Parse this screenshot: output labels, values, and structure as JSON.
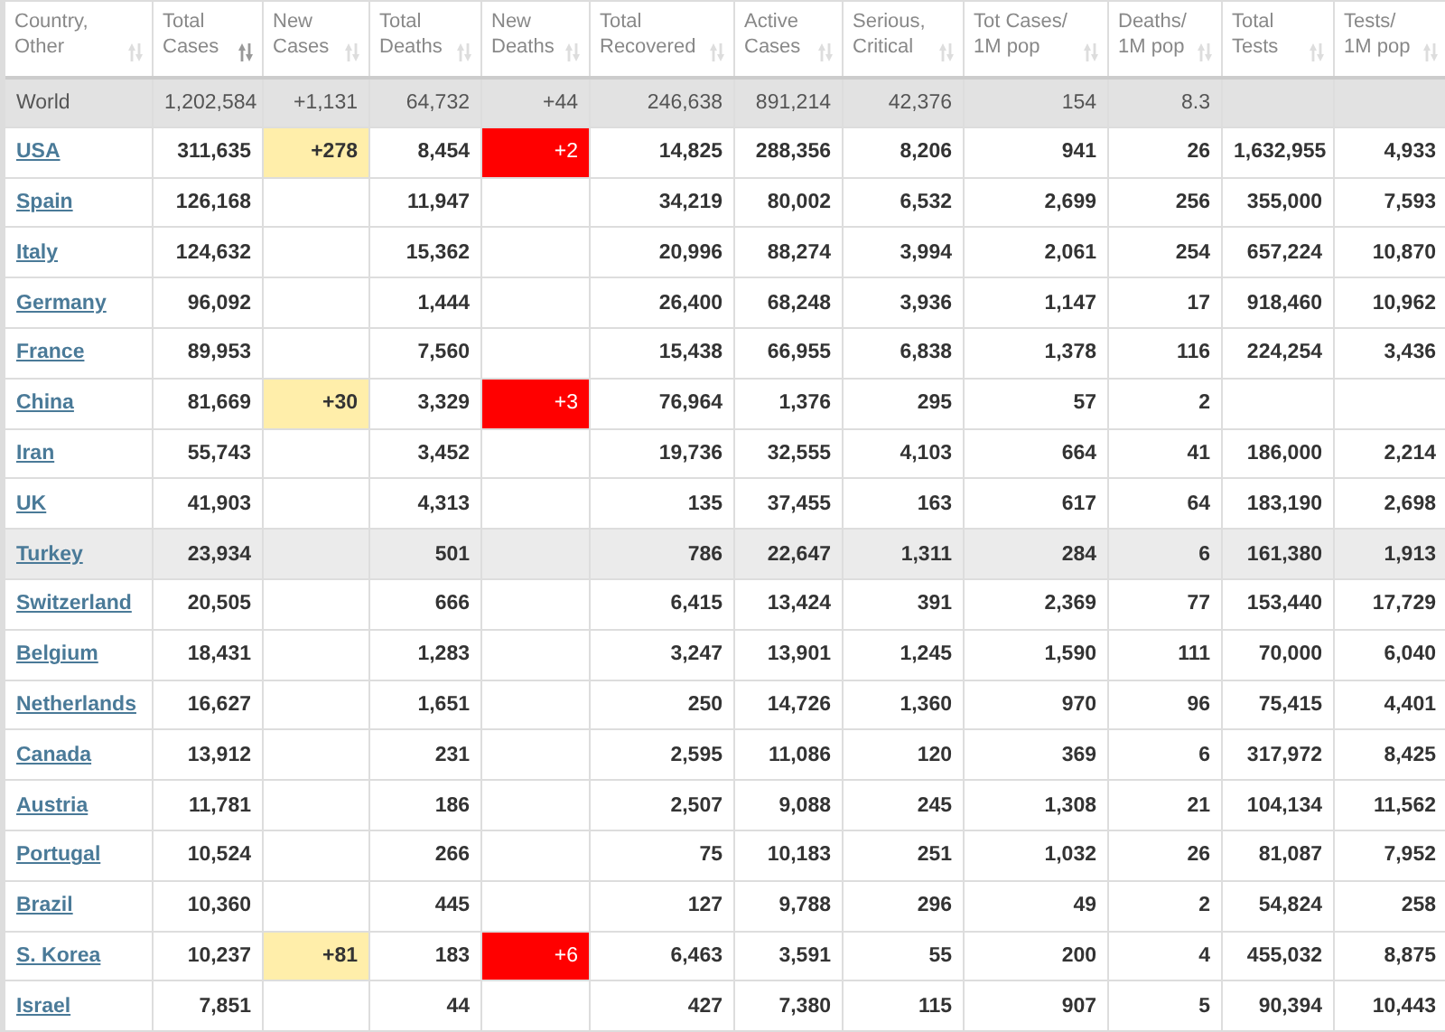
{
  "columns": [
    {
      "lines": [
        "Country,",
        "Other"
      ],
      "sorted": false
    },
    {
      "lines": [
        "Total",
        "Cases"
      ],
      "sorted": true
    },
    {
      "lines": [
        "New",
        "Cases"
      ],
      "sorted": false
    },
    {
      "lines": [
        "Total",
        "Deaths"
      ],
      "sorted": false
    },
    {
      "lines": [
        "New",
        "Deaths"
      ],
      "sorted": false
    },
    {
      "lines": [
        "Total",
        "Recovered"
      ],
      "sorted": false
    },
    {
      "lines": [
        "Active",
        "Cases"
      ],
      "sorted": false
    },
    {
      "lines": [
        "Serious,",
        "Critical"
      ],
      "sorted": false
    },
    {
      "lines": [
        "Tot Cases/",
        "1M pop"
      ],
      "sorted": false
    },
    {
      "lines": [
        "Deaths/",
        "1M pop"
      ],
      "sorted": false
    },
    {
      "lines": [
        "Total",
        "Tests"
      ],
      "sorted": false
    },
    {
      "lines": [
        "Tests/",
        "1M pop"
      ],
      "sorted": false
    }
  ],
  "world": {
    "country": "World",
    "total_cases": "1,202,584",
    "new_cases": "+1,131",
    "total_deaths": "64,732",
    "new_deaths": "+44",
    "total_recovered": "246,638",
    "active_cases": "891,214",
    "serious_critical": "42,376",
    "tot_cases_per_1m": "154",
    "deaths_per_1m": "8.3"
  },
  "rows": [
    {
      "hovered": false,
      "country": "USA",
      "total_cases": "311,635",
      "new_cases": "+278",
      "total_deaths": "8,454",
      "new_deaths": "+2",
      "total_recovered": "14,825",
      "active_cases": "288,356",
      "serious_critical": "8,206",
      "tot_cases_per_1m": "941",
      "deaths_per_1m": "26",
      "total_tests": "1,632,955",
      "tests_per_1m": "4,933"
    },
    {
      "hovered": false,
      "country": "Spain",
      "total_cases": "126,168",
      "total_deaths": "11,947",
      "total_recovered": "34,219",
      "active_cases": "80,002",
      "serious_critical": "6,532",
      "tot_cases_per_1m": "2,699",
      "deaths_per_1m": "256",
      "total_tests": "355,000",
      "tests_per_1m": "7,593"
    },
    {
      "hovered": false,
      "country": "Italy",
      "total_cases": "124,632",
      "total_deaths": "15,362",
      "total_recovered": "20,996",
      "active_cases": "88,274",
      "serious_critical": "3,994",
      "tot_cases_per_1m": "2,061",
      "deaths_per_1m": "254",
      "total_tests": "657,224",
      "tests_per_1m": "10,870"
    },
    {
      "hovered": false,
      "country": "Germany",
      "total_cases": "96,092",
      "total_deaths": "1,444",
      "total_recovered": "26,400",
      "active_cases": "68,248",
      "serious_critical": "3,936",
      "tot_cases_per_1m": "1,147",
      "deaths_per_1m": "17",
      "total_tests": "918,460",
      "tests_per_1m": "10,962"
    },
    {
      "hovered": false,
      "country": "France",
      "total_cases": "89,953",
      "total_deaths": "7,560",
      "total_recovered": "15,438",
      "active_cases": "66,955",
      "serious_critical": "6,838",
      "tot_cases_per_1m": "1,378",
      "deaths_per_1m": "116",
      "total_tests": "224,254",
      "tests_per_1m": "3,436"
    },
    {
      "hovered": false,
      "country": "China",
      "total_cases": "81,669",
      "new_cases": "+30",
      "total_deaths": "3,329",
      "new_deaths": "+3",
      "total_recovered": "76,964",
      "active_cases": "1,376",
      "serious_critical": "295",
      "tot_cases_per_1m": "57",
      "deaths_per_1m": "2"
    },
    {
      "hovered": false,
      "country": "Iran",
      "total_cases": "55,743",
      "total_deaths": "3,452",
      "total_recovered": "19,736",
      "active_cases": "32,555",
      "serious_critical": "4,103",
      "tot_cases_per_1m": "664",
      "deaths_per_1m": "41",
      "total_tests": "186,000",
      "tests_per_1m": "2,214"
    },
    {
      "hovered": false,
      "country": "UK",
      "total_cases": "41,903",
      "total_deaths": "4,313",
      "total_recovered": "135",
      "active_cases": "37,455",
      "serious_critical": "163",
      "tot_cases_per_1m": "617",
      "deaths_per_1m": "64",
      "total_tests": "183,190",
      "tests_per_1m": "2,698"
    },
    {
      "hovered": true,
      "country": "Turkey",
      "total_cases": "23,934",
      "total_deaths": "501",
      "total_recovered": "786",
      "active_cases": "22,647",
      "serious_critical": "1,311",
      "tot_cases_per_1m": "284",
      "deaths_per_1m": "6",
      "total_tests": "161,380",
      "tests_per_1m": "1,913"
    },
    {
      "hovered": false,
      "country": "Switzerland",
      "total_cases": "20,505",
      "total_deaths": "666",
      "total_recovered": "6,415",
      "active_cases": "13,424",
      "serious_critical": "391",
      "tot_cases_per_1m": "2,369",
      "deaths_per_1m": "77",
      "total_tests": "153,440",
      "tests_per_1m": "17,729"
    },
    {
      "hovered": false,
      "country": "Belgium",
      "total_cases": "18,431",
      "total_deaths": "1,283",
      "total_recovered": "3,247",
      "active_cases": "13,901",
      "serious_critical": "1,245",
      "tot_cases_per_1m": "1,590",
      "deaths_per_1m": "111",
      "total_tests": "70,000",
      "tests_per_1m": "6,040"
    },
    {
      "hovered": false,
      "country": "Netherlands",
      "total_cases": "16,627",
      "total_deaths": "1,651",
      "total_recovered": "250",
      "active_cases": "14,726",
      "serious_critical": "1,360",
      "tot_cases_per_1m": "970",
      "deaths_per_1m": "96",
      "total_tests": "75,415",
      "tests_per_1m": "4,401"
    },
    {
      "hovered": false,
      "country": "Canada",
      "total_cases": "13,912",
      "total_deaths": "231",
      "total_recovered": "2,595",
      "active_cases": "11,086",
      "serious_critical": "120",
      "tot_cases_per_1m": "369",
      "deaths_per_1m": "6",
      "total_tests": "317,972",
      "tests_per_1m": "8,425"
    },
    {
      "hovered": false,
      "country": "Austria",
      "total_cases": "11,781",
      "total_deaths": "186",
      "total_recovered": "2,507",
      "active_cases": "9,088",
      "serious_critical": "245",
      "tot_cases_per_1m": "1,308",
      "deaths_per_1m": "21",
      "total_tests": "104,134",
      "tests_per_1m": "11,562"
    },
    {
      "hovered": false,
      "country": "Portugal",
      "total_cases": "10,524",
      "total_deaths": "266",
      "total_recovered": "75",
      "active_cases": "10,183",
      "serious_critical": "251",
      "tot_cases_per_1m": "1,032",
      "deaths_per_1m": "26",
      "total_tests": "81,087",
      "tests_per_1m": "7,952"
    },
    {
      "hovered": false,
      "country": "Brazil",
      "total_cases": "10,360",
      "total_deaths": "445",
      "total_recovered": "127",
      "active_cases": "9,788",
      "serious_critical": "296",
      "tot_cases_per_1m": "49",
      "deaths_per_1m": "2",
      "total_tests": "54,824",
      "tests_per_1m": "258"
    },
    {
      "hovered": false,
      "country": "S. Korea",
      "total_cases": "10,237",
      "new_cases": "+81",
      "total_deaths": "183",
      "new_deaths": "+6",
      "total_recovered": "6,463",
      "active_cases": "3,591",
      "serious_critical": "55",
      "tot_cases_per_1m": "200",
      "deaths_per_1m": "4",
      "total_tests": "455,032",
      "tests_per_1m": "8,875"
    },
    {
      "hovered": false,
      "country": "Israel",
      "total_cases": "7,851",
      "total_deaths": "44",
      "total_recovered": "427",
      "active_cases": "7,380",
      "serious_critical": "115",
      "tot_cases_per_1m": "907",
      "deaths_per_1m": "5",
      "total_tests": "90,394",
      "tests_per_1m": "10,443"
    }
  ]
}
